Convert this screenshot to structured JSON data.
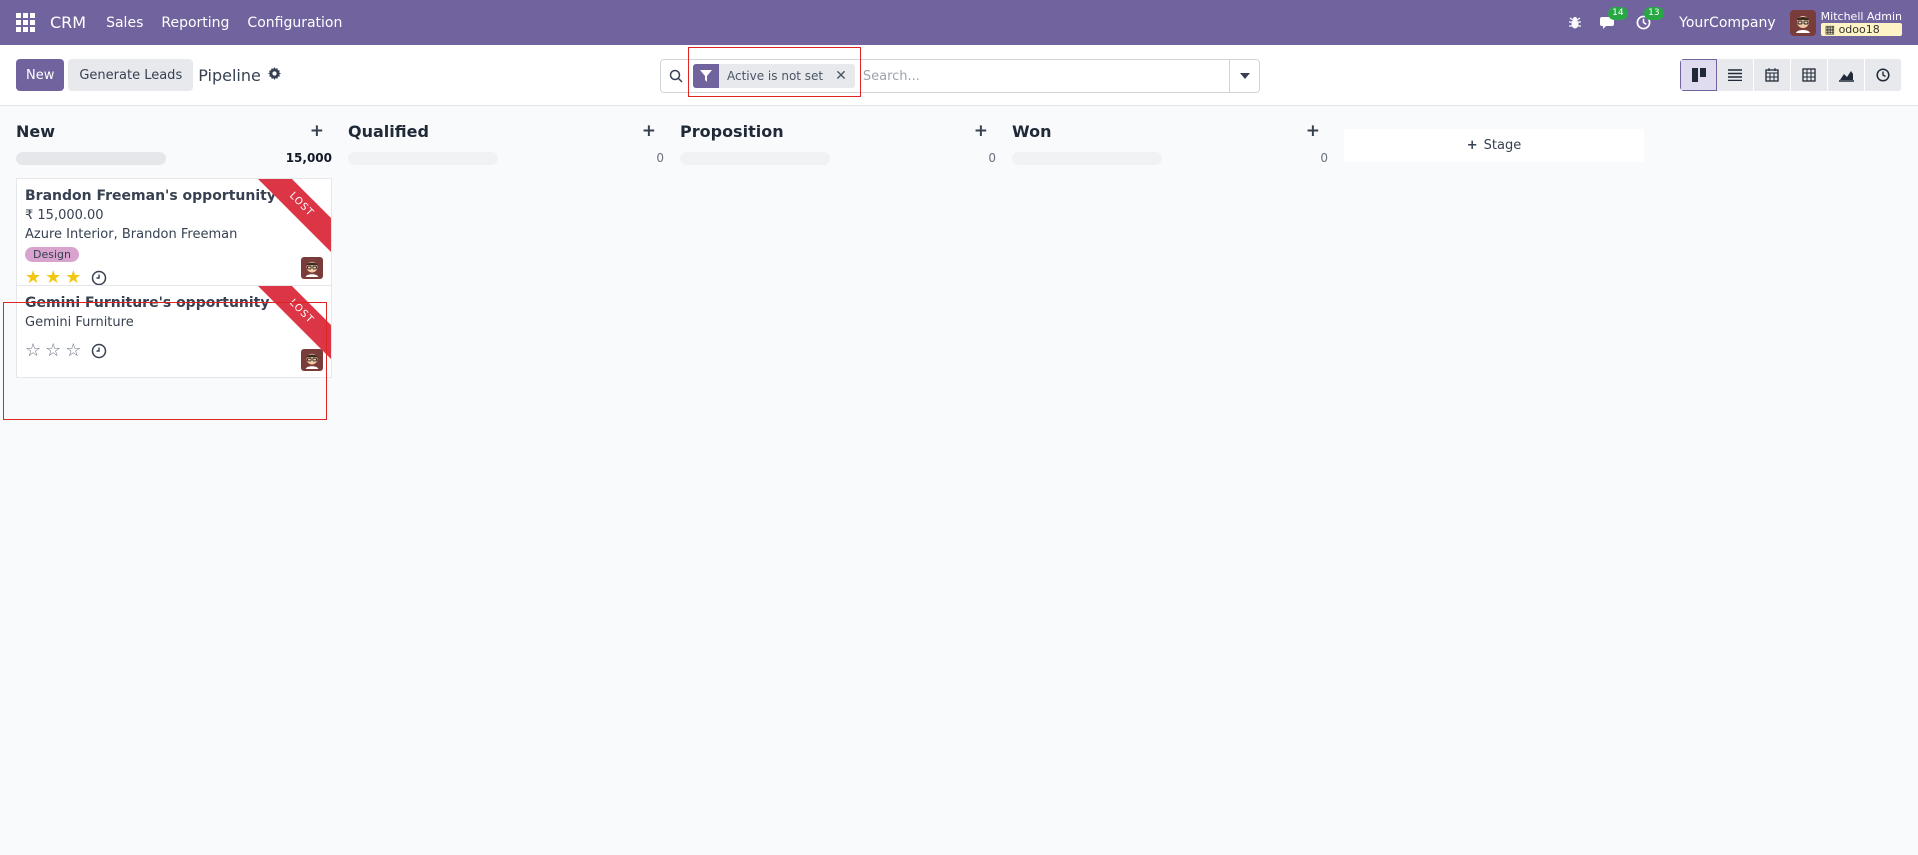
{
  "navbar": {
    "app_name": "CRM",
    "menu": [
      "Sales",
      "Reporting",
      "Configuration"
    ],
    "messages_count": "14",
    "activities_count": "13",
    "company": "YourCompany",
    "user_name": "Mitchell Admin",
    "database": "odoo18"
  },
  "control": {
    "new_label": "New",
    "generate_label": "Generate Leads",
    "breadcrumb": "Pipeline",
    "search": {
      "facet_label": "Active is not set",
      "placeholder": "Search..."
    }
  },
  "kanban": {
    "columns": [
      {
        "title": "New",
        "total": "15,000",
        "cards": [
          {
            "title": "Brandon Freeman's opportunity",
            "revenue": "₹ 15,000.00",
            "contact": "Azure Interior, Brandon Freeman",
            "tag": "Design",
            "ribbon": "LOST",
            "stars": 3
          },
          {
            "title": "Gemini Furniture's opportunity",
            "contact": "Gemini Furniture",
            "ribbon": "LOST",
            "stars": 0
          }
        ]
      },
      {
        "title": "Qualified",
        "total": "0"
      },
      {
        "title": "Proposition",
        "total": "0"
      },
      {
        "title": "Won",
        "total": "0"
      }
    ],
    "add_stage_label": "Stage"
  },
  "colors": {
    "brand": "#71639e",
    "lost": "#dc3545",
    "star": "#f3c711",
    "tag": "#d9a3cf"
  }
}
